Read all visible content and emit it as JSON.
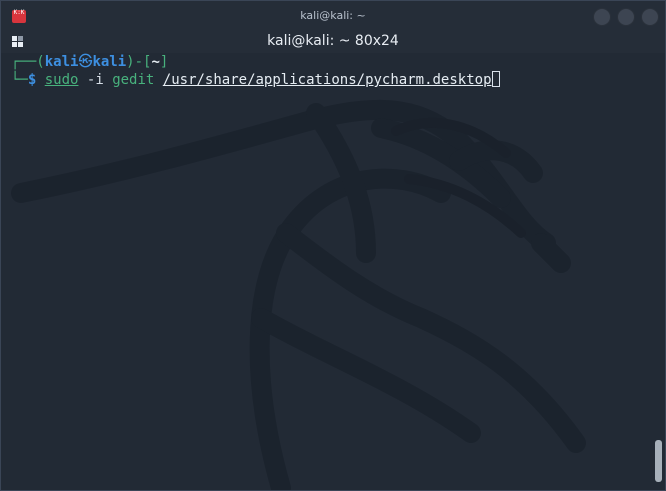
{
  "titlebar": {
    "title": "kali@kali: ~",
    "app_icon": "terminal-emulator-icon",
    "app_icon_text": "K:K",
    "buttons": [
      "minimize-button",
      "maximize-button",
      "close-button"
    ]
  },
  "tab": {
    "title": "kali@kali: ~ 80x24",
    "menu_icon": "tab-menu-icon"
  },
  "terminal": {
    "prompt": {
      "open": "┌──(",
      "user": "kali",
      "skull": "㉿",
      "host": "kali",
      "mid": ")-[",
      "dir": "~",
      "close": "]",
      "second_prefix": "└─",
      "dollar": "$"
    },
    "command": {
      "sudo": "sudo",
      "flag": "-i",
      "program": "gedit",
      "path": "/usr/share/applications/pycharm.desktop"
    }
  },
  "colors": {
    "prompt": "#3d8fe0",
    "command": "#48b27d",
    "background": "#222a35"
  }
}
